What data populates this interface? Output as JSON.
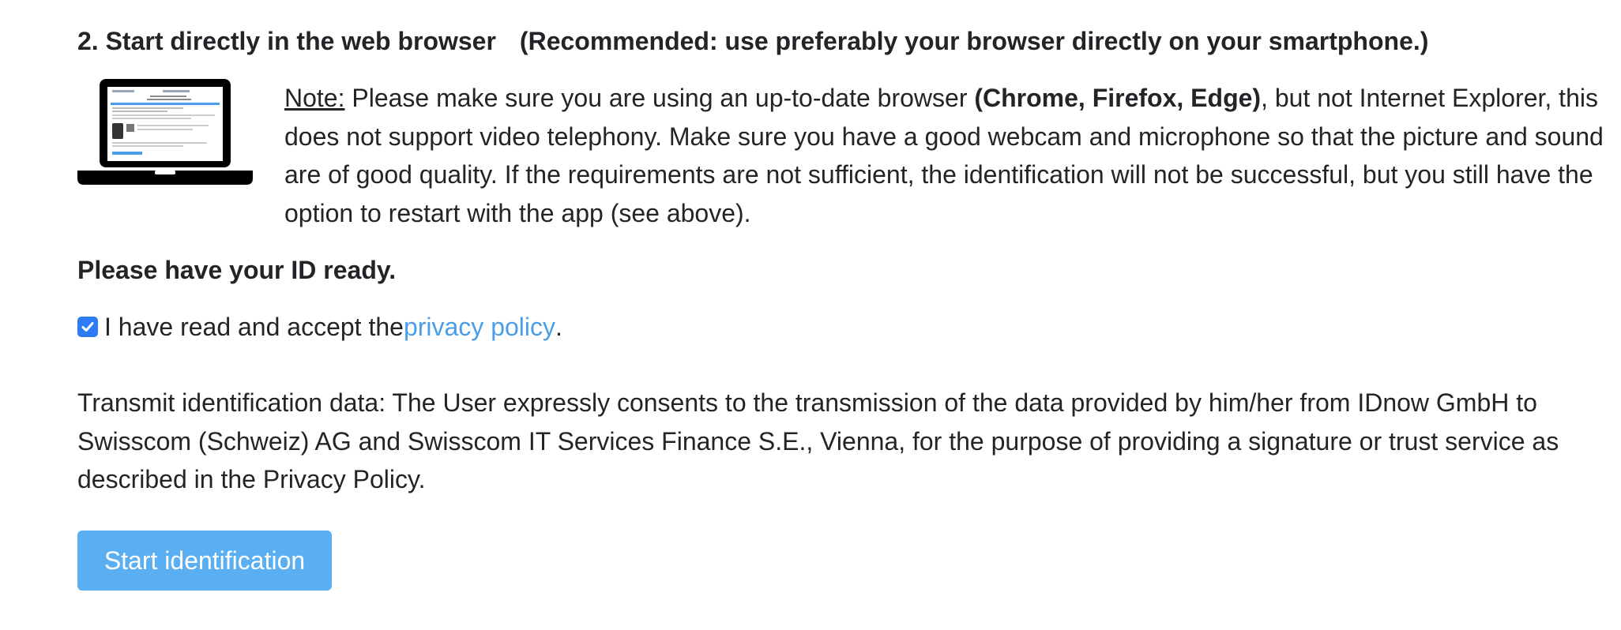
{
  "section": {
    "heading": "2. Start directly in the web browser",
    "recommended": "(Recommended: use preferably your browser directly on your smartphone.)"
  },
  "note": {
    "label": "Note:",
    "text_before": " Please make sure you are using an up-to-date browser ",
    "browsers": "(Chrome, Firefox, Edge)",
    "text_after": ", but not Internet Explorer, this does not support video telephony. Make sure you have a good webcam and microphone so that the picture and sound are of good quality. If the requirements are not sufficient, the identification will not be successful, but you still have the option to restart with the app (see above)."
  },
  "id_ready": "Please have your ID ready.",
  "consent": {
    "checked": true,
    "text_before": "I have read and accept the ",
    "link": "privacy policy",
    "text_after": "."
  },
  "transmit_text": "Transmit identification data: The User expressly consents to the transmission of the data provided by him/her from IDnow GmbH to Swisscom (Schweiz) AG and Swisscom IT Services Finance S.E., Vienna, for the purpose of providing a signature or trust service as described in the Privacy Policy.",
  "button": {
    "label": "Start identification"
  },
  "colors": {
    "button": "#5aaef2",
    "link": "#4a9ee8",
    "checkbox": "#2f7bf6",
    "text": "#222427"
  },
  "icons": {
    "laptop": "laptop-screenshot-icon",
    "checkbox": "checkmark-icon"
  }
}
